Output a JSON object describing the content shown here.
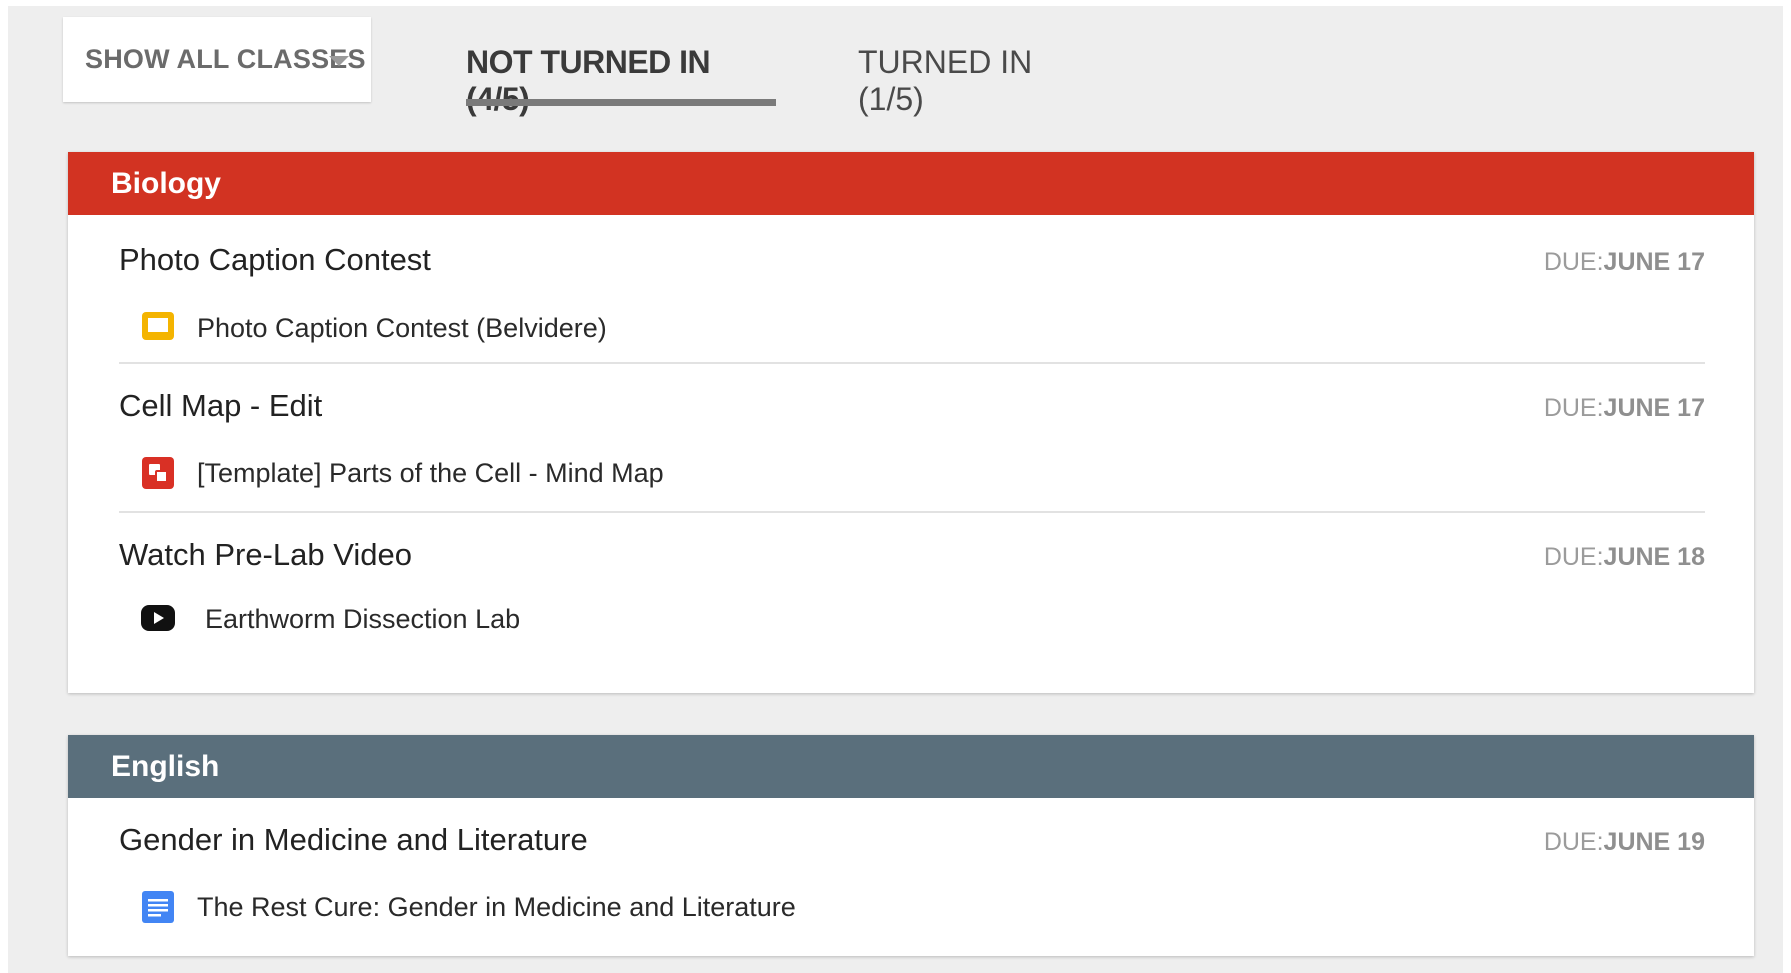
{
  "filter": {
    "selected": "SHOW ALL CLASSES"
  },
  "tabs": [
    {
      "label": "NOT TURNED IN (4/5)",
      "active": true
    },
    {
      "label": "TURNED IN (1/5)",
      "active": false
    }
  ],
  "colors": {
    "background": "#eeeeee",
    "biology_header": "#d23322",
    "english_header": "#5a6f7c",
    "tab_underline": "#7a7a7a",
    "slides_icon": "#f4b400",
    "mindmap_icon": "#d93025",
    "youtube_icon": "#111111",
    "docs_icon": "#4285f4"
  },
  "classes": [
    {
      "name": "Biology",
      "assignments": [
        {
          "title": "Photo Caption Contest",
          "due_label": "DUE:",
          "due_date": "JUNE 17",
          "material": {
            "icon": "slides-icon",
            "title": "Photo Caption Contest (Belvidere)"
          }
        },
        {
          "title": "Cell Map - Edit",
          "due_label": "DUE:",
          "due_date": "JUNE 17",
          "material": {
            "icon": "mind-map-icon",
            "title": "[Template] Parts of the Cell - Mind Map"
          }
        },
        {
          "title": "Watch Pre-Lab Video",
          "due_label": "DUE:",
          "due_date": "JUNE 18",
          "material": {
            "icon": "youtube-icon",
            "title": "Earthworm Dissection Lab"
          }
        }
      ]
    },
    {
      "name": "English",
      "assignments": [
        {
          "title": "Gender in Medicine and Literature",
          "due_label": "DUE:",
          "due_date": "JUNE 19",
          "material": {
            "icon": "docs-icon",
            "title": "The Rest Cure: Gender in Medicine and Literature"
          }
        }
      ]
    }
  ]
}
